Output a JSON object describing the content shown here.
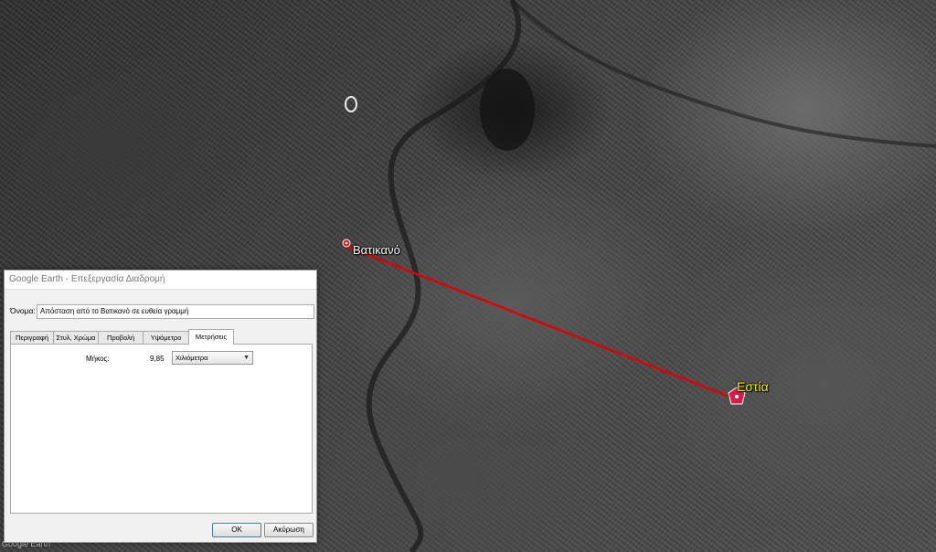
{
  "map": {
    "start_label": "Βατικανό",
    "end_label": "Εστία",
    "watermark": "Google Earth",
    "line_color": "#e00000"
  },
  "dialog": {
    "title": "Google Earth - Επεξεργασία Διαδρομή",
    "name_label": "Όνομα:",
    "name_value": "Απόσταση από το Βατικανό σε ευθεία γραμμή",
    "tabs": [
      "Περιγραφή",
      "Στυλ, Χρώμα",
      "Προβολή",
      "Υψόμετρο",
      "Μετρήσεις"
    ],
    "active_tab": "Μετρήσεις",
    "length_label": "Μήκος:",
    "length_value": "9,85",
    "unit": "Χιλιόμετρα",
    "ok_label": "OK",
    "cancel_label": "Ακύρωση"
  }
}
